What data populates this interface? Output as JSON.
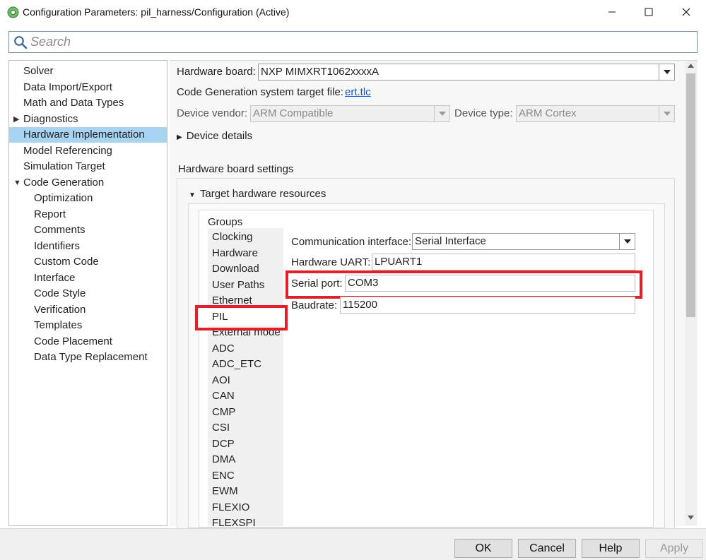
{
  "window": {
    "title": "Configuration Parameters: pil_harness/Configuration (Active)"
  },
  "search": {
    "placeholder": "Search"
  },
  "tree": {
    "items": [
      {
        "label": "Solver"
      },
      {
        "label": "Data Import/Export"
      },
      {
        "label": "Math and Data Types"
      },
      {
        "label": "Diagnostics"
      },
      {
        "label": "Hardware Implementation"
      },
      {
        "label": "Model Referencing"
      },
      {
        "label": "Simulation Target"
      },
      {
        "label": "Code Generation"
      },
      {
        "label": "Optimization"
      },
      {
        "label": "Report"
      },
      {
        "label": "Comments"
      },
      {
        "label": "Identifiers"
      },
      {
        "label": "Custom Code"
      },
      {
        "label": "Interface"
      },
      {
        "label": "Code Style"
      },
      {
        "label": "Verification"
      },
      {
        "label": "Templates"
      },
      {
        "label": "Code Placement"
      },
      {
        "label": "Data Type Replacement"
      }
    ],
    "selected": "Hardware Implementation"
  },
  "hardware": {
    "board_label": "Hardware board:",
    "board_value": "NXP MIMXRT1062xxxxA",
    "target_file_label": "Code Generation system target file:",
    "target_file_link": "ert.tlc",
    "vendor_label": "Device vendor:",
    "vendor_value": "ARM Compatible",
    "type_label": "Device type:",
    "type_value": "ARM Cortex",
    "device_details": "Device details",
    "board_settings_title": "Hardware board settings",
    "target_resources": "Target hardware resources"
  },
  "groups": {
    "title": "Groups",
    "items": [
      "Clocking",
      "Hardware",
      "Download",
      "User Paths",
      "Ethernet",
      "PIL",
      "External mode",
      "ADC",
      "ADC_ETC",
      "AOI",
      "CAN",
      "CMP",
      "CSI",
      "DCP",
      "DMA",
      "ENC",
      "EWM",
      "FLEXIO",
      "FLEXSPI"
    ],
    "selected": "PIL"
  },
  "pil": {
    "comm_label": "Communication interface:",
    "comm_value": "Serial Interface",
    "uart_label": "Hardware UART:",
    "uart_value": "LPUART1",
    "port_label": "Serial port:",
    "port_value": "COM3",
    "baud_label": "Baudrate:",
    "baud_value": "115200"
  },
  "buttons": {
    "ok": "OK",
    "cancel": "Cancel",
    "help": "Help",
    "apply": "Apply"
  },
  "colors": {
    "selection": "#a8d3f1",
    "highlight": "#e0202a",
    "link": "#0b57d0"
  }
}
